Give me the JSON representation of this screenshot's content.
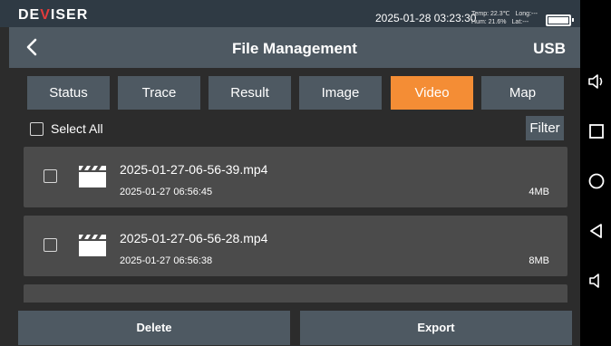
{
  "status_bar": {
    "logo_pre": "DE",
    "logo_v": "V",
    "logo_post": "ISER",
    "datetime": "2025-01-28 03:23:30",
    "temp": "Temp:  22.3℃",
    "long": "Long:---",
    "hum": "Hum:  21.6%",
    "lat": "Lat:---"
  },
  "header": {
    "title": "File Management",
    "storage": "USB",
    "back_icon": "chevron-left-icon"
  },
  "tabs": [
    {
      "label": "Status",
      "active": false
    },
    {
      "label": "Trace",
      "active": false
    },
    {
      "label": "Result",
      "active": false
    },
    {
      "label": "Image",
      "active": false
    },
    {
      "label": "Video",
      "active": true
    },
    {
      "label": "Map",
      "active": false
    }
  ],
  "toolbar": {
    "select_all": "Select All",
    "filter": "Filter"
  },
  "files": [
    {
      "name": "2025-01-27-06-56-39.mp4",
      "time": "2025-01-27 06:56:45",
      "size": "4MB",
      "icon": "clapperboard-icon"
    },
    {
      "name": "2025-01-27-06-56-28.mp4",
      "time": "2025-01-27 06:56:38",
      "size": "8MB",
      "icon": "clapperboard-icon"
    }
  ],
  "actions": {
    "delete": "Delete",
    "export": "Export"
  },
  "colors": {
    "accent": "#f48d35",
    "panel": "#4e5962",
    "item": "#4b4b4b",
    "background": "#2c2c2c",
    "logo_v": "#e23b3b"
  },
  "system_nav": [
    "volume-up-icon",
    "square-icon",
    "circle-icon",
    "triangle-back-icon",
    "volume-down-icon"
  ]
}
